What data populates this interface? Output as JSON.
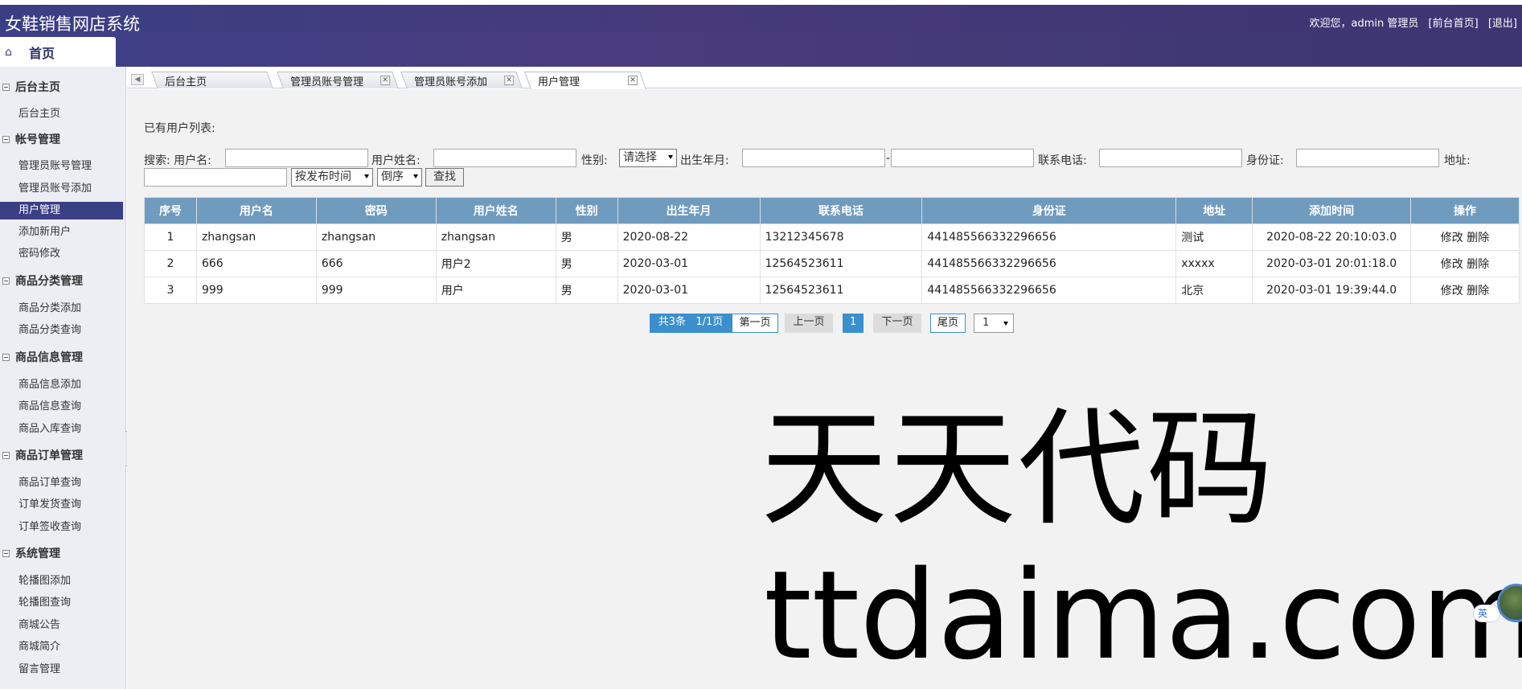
{
  "header": {
    "app_title": "女鞋销售网店系统",
    "welcome": "欢迎您，",
    "user": "admin 管理员",
    "front_link": "[前台首页]",
    "logout_link": "[退出]"
  },
  "home_tab": {
    "label": "首页",
    "icon": "home-icon"
  },
  "sidebar": {
    "groups": [
      {
        "title": "后台主页",
        "items": [
          "后台主页"
        ]
      },
      {
        "title": "帐号管理",
        "items": [
          "管理员账号管理",
          "管理员账号添加",
          "用户管理",
          "添加新用户",
          "密码修改"
        ]
      },
      {
        "title": "商品分类管理",
        "items": [
          "商品分类添加",
          "商品分类查询"
        ]
      },
      {
        "title": "商品信息管理",
        "items": [
          "商品信息添加",
          "商品信息查询",
          "商品入库查询"
        ]
      },
      {
        "title": "商品订单管理",
        "items": [
          "商品订单查询",
          "订单发货查询",
          "订单签收查询"
        ]
      },
      {
        "title": "系统管理",
        "items": [
          "轮播图添加",
          "轮播图查询",
          "商城公告",
          "商城简介",
          "留言管理"
        ]
      }
    ],
    "active_item": "用户管理"
  },
  "tabs": [
    {
      "label": "后台主页",
      "closable": false
    },
    {
      "label": "管理员账号管理",
      "closable": true
    },
    {
      "label": "管理员账号添加",
      "closable": true
    },
    {
      "label": "用户管理",
      "closable": true,
      "active": true
    }
  ],
  "main": {
    "caption": "已有用户列表:",
    "search": {
      "prefix": "搜索: 用户名:",
      "fullname_label": "用户姓名:",
      "gender_label": "性别:",
      "gender_value": "请选择",
      "birth_label": "出生年月:",
      "birth_sep": "-",
      "phone_label": "联系电话:",
      "id_label": "身份证:",
      "address_label": "地址:",
      "sort_value": "按发布时间",
      "order_value": "倒序",
      "search_button": "查找",
      "username_value": "",
      "fullname_value": "",
      "birth_from": "",
      "birth_to": "",
      "phone_value": "",
      "id_value": "",
      "address_value": ""
    },
    "table": {
      "columns": [
        "序号",
        "用户名",
        "密码",
        "用户姓名",
        "性别",
        "出生年月",
        "联系电话",
        "身份证",
        "地址",
        "添加时间",
        "操作"
      ],
      "rows": [
        [
          "1",
          "zhangsan",
          "zhangsan",
          "zhangsan",
          "男",
          "2020-08-22",
          "13212345678",
          "441485566332296656",
          "测试",
          "2020-08-22 20:10:03.0"
        ],
        [
          "2",
          "666",
          "666",
          "用户2",
          "男",
          "2020-03-01",
          "12564523611",
          "441485566332296656",
          "xxxxx",
          "2020-03-01 20:01:18.0"
        ],
        [
          "3",
          "999",
          "999",
          "用户",
          "男",
          "2020-03-01",
          "12564523611",
          "441485566332296656",
          "北京",
          "2020-03-01 19:39:44.0"
        ]
      ],
      "edit_label": "修改",
      "delete_label": "删除"
    },
    "pager": {
      "total": "共3条",
      "pages": "1/1页",
      "first": "第一页",
      "prev": "上一页",
      "current": "1",
      "next": "下一页",
      "last": "尾页",
      "select_value": "1"
    }
  },
  "watermark": {
    "line1": "天天代码",
    "line2": "ttdaima.com"
  },
  "floating": {
    "ime_label": "英"
  }
}
